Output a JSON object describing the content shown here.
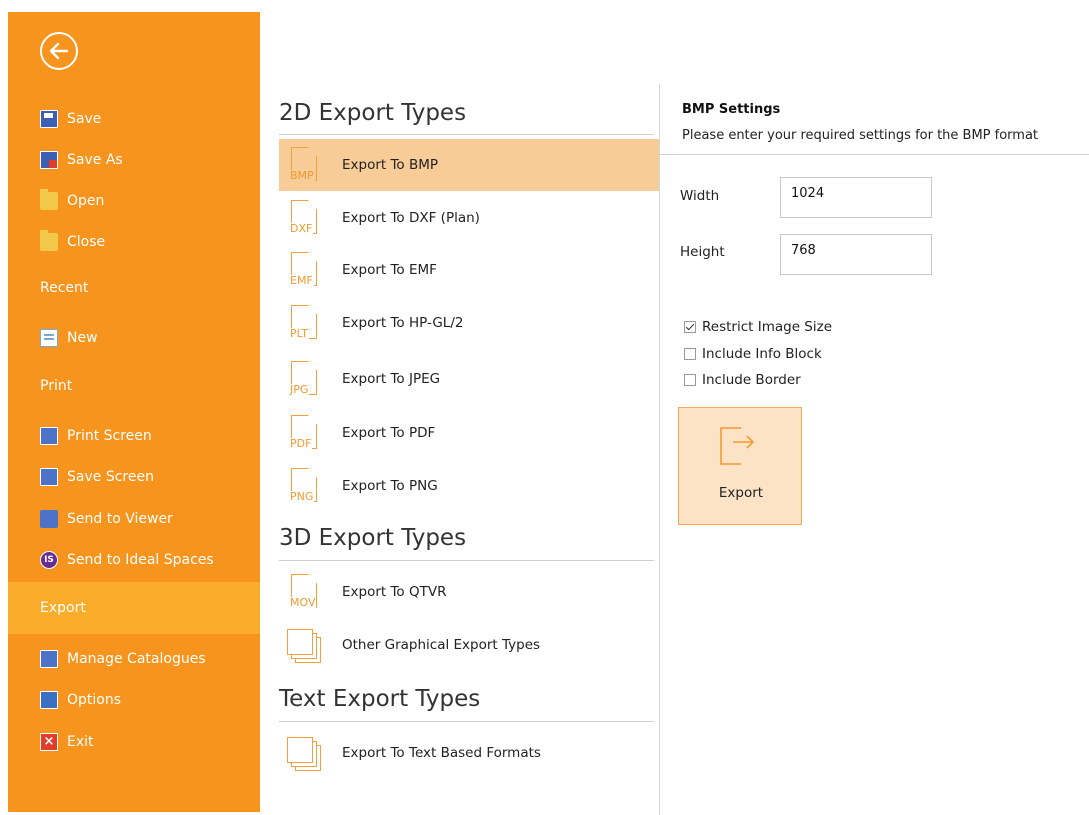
{
  "sidebar": {
    "items": [
      {
        "label": "Save",
        "icon": "save-icon"
      },
      {
        "label": "Save As",
        "icon": "save-as-icon"
      },
      {
        "label": "Open",
        "icon": "open-folder-icon"
      },
      {
        "label": "Close",
        "icon": "close-folder-icon"
      },
      {
        "label": "Recent"
      },
      {
        "label": "New",
        "icon": "new-document-icon"
      },
      {
        "label": "Print"
      },
      {
        "label": "Print Screen",
        "icon": "print-screen-icon"
      },
      {
        "label": "Save Screen",
        "icon": "save-screen-icon"
      },
      {
        "label": "Send to Viewer",
        "icon": "send-to-viewer-icon"
      },
      {
        "label": "Send to Ideal Spaces",
        "icon": "ideal-spaces-icon"
      },
      {
        "label": "Export"
      },
      {
        "label": "Manage Catalogues",
        "icon": "catalogues-icon"
      },
      {
        "label": "Options",
        "icon": "options-icon"
      },
      {
        "label": "Exit",
        "icon": "exit-icon"
      }
    ],
    "active": "Export",
    "accent": "#f7941d",
    "active_color": "#fbac2b"
  },
  "export_types": {
    "sections": [
      {
        "title": "2D Export Types",
        "items": [
          {
            "label": "Export To BMP",
            "ext": "BMP",
            "selected": true
          },
          {
            "label": "Export To DXF (Plan)",
            "ext": "DXF"
          },
          {
            "label": "Export To EMF",
            "ext": "EMF"
          },
          {
            "label": "Export To HP-GL/2",
            "ext": "PLT"
          },
          {
            "label": "Export To JPEG",
            "ext": "JPG"
          },
          {
            "label": "Export To PDF",
            "ext": "PDF"
          },
          {
            "label": "Export To PNG",
            "ext": "PNG"
          }
        ]
      },
      {
        "title": "3D Export Types",
        "items": [
          {
            "label": "Export To QTVR",
            "ext": "MOV"
          },
          {
            "label": "Other Graphical Export Types",
            "icon": "graphical-export-icon"
          }
        ]
      },
      {
        "title": "Text Export Types",
        "items": [
          {
            "label": "Export To Text Based Formats",
            "icon": "text-export-icon"
          }
        ]
      }
    ],
    "selected_color": "#f8cc97"
  },
  "settings": {
    "title": "BMP Settings",
    "subtitle": "Please enter your required settings for the BMP format",
    "width_label": "Width",
    "width_value": "1024",
    "height_label": "Height",
    "height_value": "768",
    "checkboxes": [
      {
        "label": "Restrict Image Size",
        "checked": true
      },
      {
        "label": "Include Info Block",
        "checked": false
      },
      {
        "label": "Include Border",
        "checked": false
      }
    ],
    "export_button": "Export"
  }
}
